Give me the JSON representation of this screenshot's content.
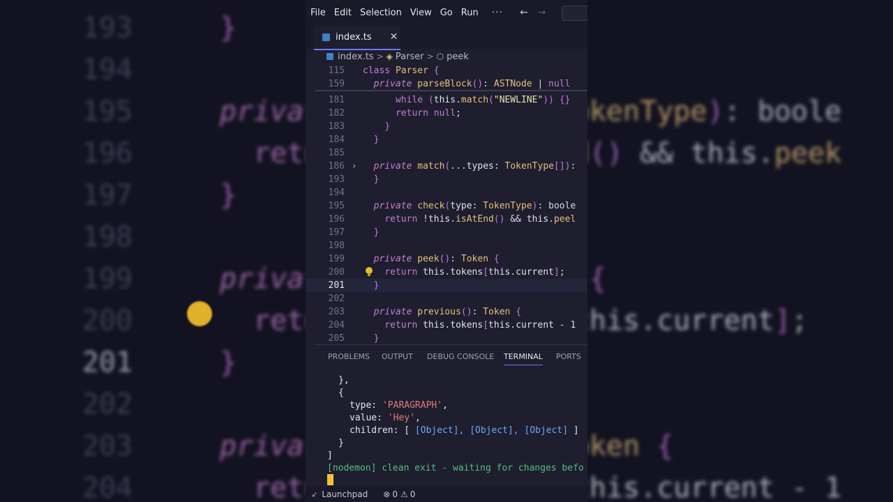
{
  "menu": {
    "items": [
      "File",
      "Edit",
      "Selection",
      "View",
      "Go",
      "Run"
    ],
    "more": "···",
    "back": "←",
    "forward": "→"
  },
  "tab": {
    "label": "index.ts",
    "close": "✕"
  },
  "breadcrumb": {
    "file": "index.ts",
    "class": "Parser",
    "method": "peek",
    "sep": ">"
  },
  "sticky": [
    {
      "num": "115",
      "code": "class Parser {"
    },
    {
      "num": "159",
      "code": "  private parseBlock(): ASTNode | null"
    }
  ],
  "editor_lines": [
    {
      "num": "181",
      "code": "      while (this.match(\"NEWLINE\")) {}"
    },
    {
      "num": "182",
      "code": "      return null;"
    },
    {
      "num": "183",
      "code": "    }"
    },
    {
      "num": "184",
      "code": "  }"
    },
    {
      "num": "185",
      "code": ""
    },
    {
      "num": "186",
      "code": "  private match(...types: TokenType[]):"
    },
    {
      "num": "193",
      "code": "  }"
    },
    {
      "num": "194",
      "code": ""
    },
    {
      "num": "195",
      "code": "  private check(type: TokenType): boole"
    },
    {
      "num": "196",
      "code": "    return !this.isAtEnd() && this.peel"
    },
    {
      "num": "197",
      "code": "  }"
    },
    {
      "num": "198",
      "code": ""
    },
    {
      "num": "199",
      "code": "  private peek(): Token {"
    },
    {
      "num": "200",
      "code": "    return this.tokens[this.current];"
    },
    {
      "num": "201",
      "code": "  }"
    },
    {
      "num": "202",
      "code": ""
    },
    {
      "num": "203",
      "code": "  private previous(): Token {"
    },
    {
      "num": "204",
      "code": "    return this.tokens[this.current - 1"
    },
    {
      "num": "205",
      "code": "  }"
    }
  ],
  "panel_tabs": [
    "PROBLEMS",
    "OUTPUT",
    "DEBUG CONSOLE",
    "TERMINAL",
    "PORTS"
  ],
  "terminal": {
    "l1": "},",
    "l2": "{",
    "type_key": "type: ",
    "type_val": "'PARAGRAPH'",
    "value_key": "value: ",
    "value_val": "'Hey'",
    "children_key": "children: [ ",
    "children_val": "[Object], [Object], [Object]",
    "children_end": " ]",
    "l6": "}",
    "l7": "]",
    "nodemon": "[nodemon] clean exit - waiting for changes befo"
  },
  "status": {
    "launchpad": "Launchpad",
    "errors": "0",
    "warnings": "0"
  },
  "background": {
    "lines": [
      {
        "num": "193",
        "code": "}"
      },
      {
        "num": "194",
        "code": ""
      },
      {
        "num": "195",
        "code": "private check(type: TokenType): boole"
      },
      {
        "num": "196",
        "code": "  return !this.isAtEnd() && this.peek"
      },
      {
        "num": "197",
        "code": "}"
      },
      {
        "num": "198",
        "code": ""
      },
      {
        "num": "199",
        "code": "private peek(): Token {"
      },
      {
        "num": "200",
        "code": "  return this.tokens[this.current];"
      },
      {
        "num": "201",
        "code": "}"
      },
      {
        "num": "202",
        "code": ""
      },
      {
        "num": "203",
        "code": "private previous(): Token {"
      },
      {
        "num": "204",
        "code": "  return this.tokens[this.current - 1"
      }
    ]
  }
}
